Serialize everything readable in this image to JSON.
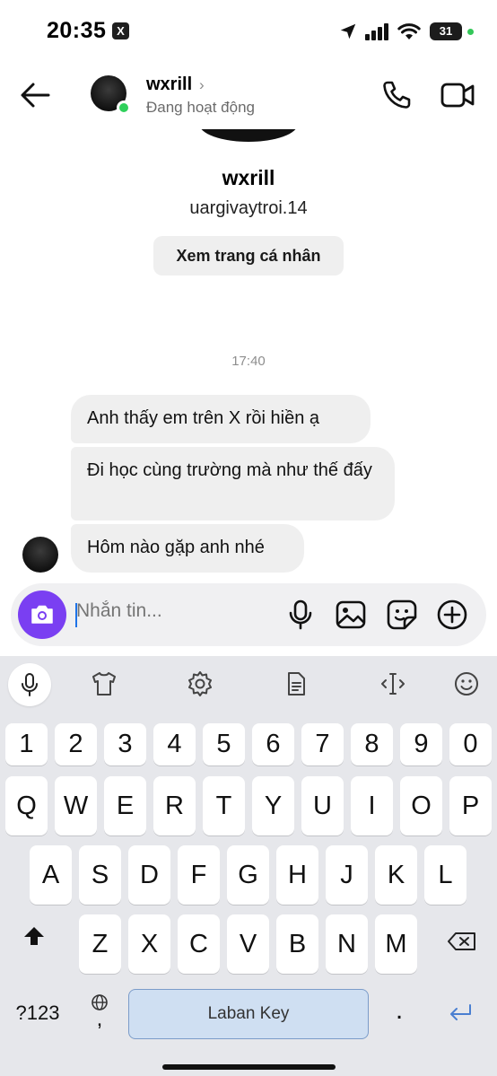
{
  "status_bar": {
    "time": "20:35",
    "x_badge": "X",
    "battery": "31"
  },
  "header": {
    "name": "wxrill",
    "chevron": "›",
    "status": "Đang hoạt động"
  },
  "profile": {
    "name": "wxrill",
    "username": "uargivaytroi.14",
    "view_profile_label": "Xem trang cá nhân"
  },
  "conversation": {
    "time_separator": "17:40",
    "messages": [
      {
        "text": "Anh thấy em trên X rồi hiền ạ"
      },
      {
        "text": "Đi học cùng trường mà như thế đấy"
      },
      {
        "text": "Hôm nào gặp anh nhé"
      }
    ]
  },
  "composer": {
    "placeholder": "Nhắn tin..."
  },
  "keyboard": {
    "numbers": [
      "1",
      "2",
      "3",
      "4",
      "5",
      "6",
      "7",
      "8",
      "9",
      "0"
    ],
    "row1": [
      "Q",
      "W",
      "E",
      "R",
      "T",
      "Y",
      "U",
      "I",
      "O",
      "P"
    ],
    "row2": [
      "A",
      "S",
      "D",
      "F",
      "G",
      "H",
      "J",
      "K",
      "L"
    ],
    "row3": [
      "Z",
      "X",
      "C",
      "V",
      "B",
      "N",
      "M"
    ],
    "mode_label": "?123",
    "comma_label": ",",
    "space_label": "Laban Key",
    "period_label": "."
  },
  "colors": {
    "accent": "#7a3ff2",
    "online": "#2fd05b",
    "bubble": "#efefef",
    "keyboard_bg": "#e6e7eb"
  }
}
